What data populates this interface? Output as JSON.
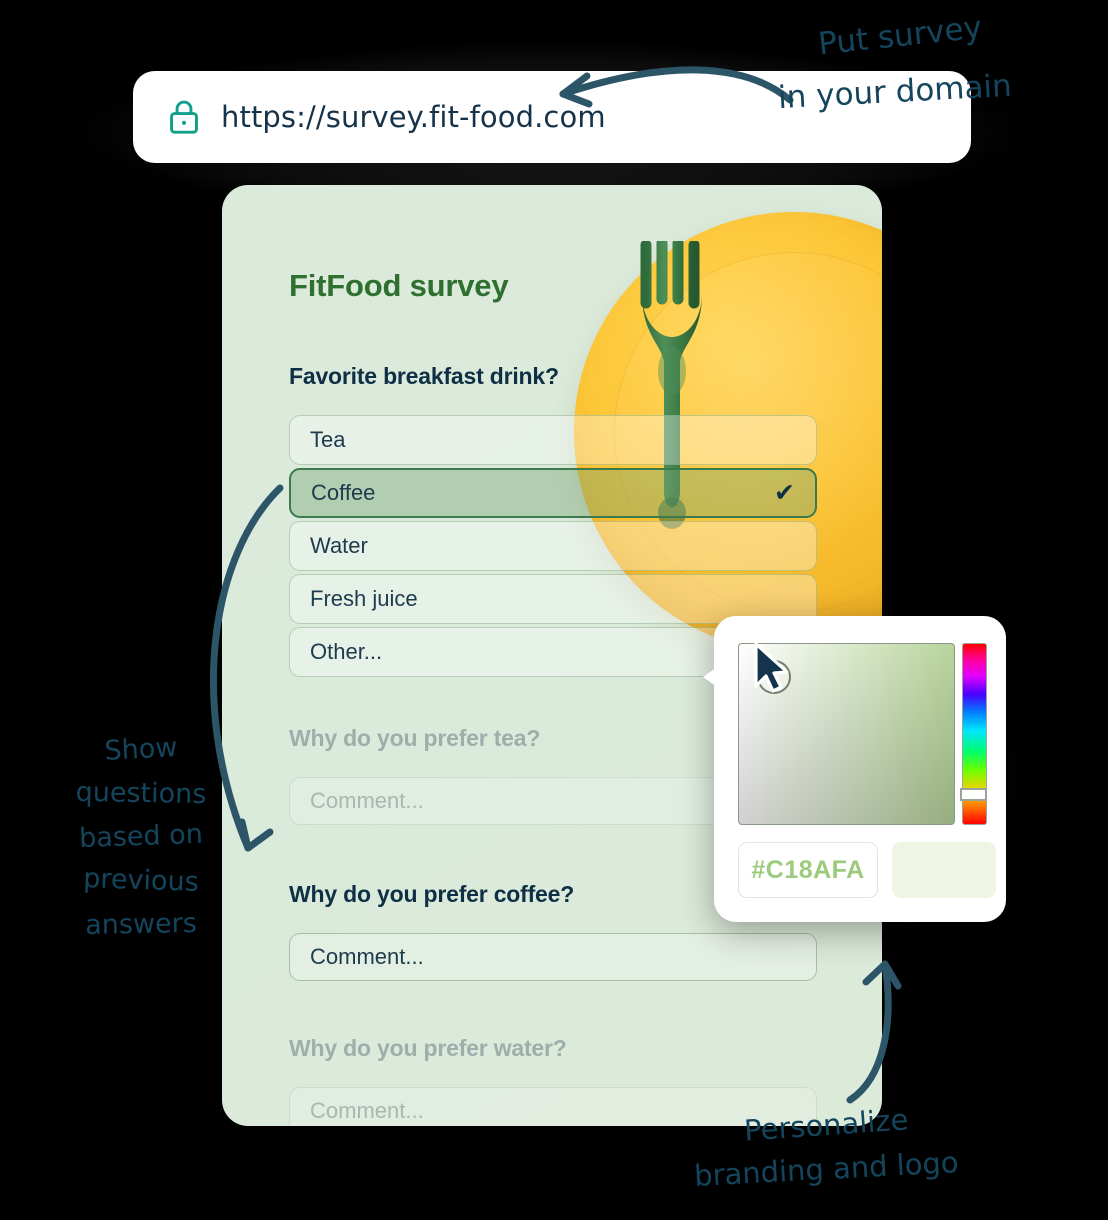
{
  "browser": {
    "lock_icon": "lock-icon",
    "url": "https://survey.fit-food.com"
  },
  "annotations": {
    "domain": {
      "line1": "Put survey",
      "line2": "in your domain"
    },
    "logic": {
      "line1": "Show",
      "line2": "questions",
      "line3": "based on",
      "line4": "previous",
      "line5": "answers"
    },
    "branding": {
      "line1": "Personalize",
      "line2": "branding and logo"
    }
  },
  "survey": {
    "title": "FitFood survey",
    "question_1": {
      "label": "Favorite breakfast drink?",
      "options": [
        {
          "label": "Tea",
          "selected": false
        },
        {
          "label": "Coffee",
          "selected": true
        },
        {
          "label": "Water",
          "selected": false
        },
        {
          "label": "Fresh juice",
          "selected": false
        },
        {
          "label": "Other...",
          "selected": false
        }
      ],
      "check_glyph": "✔"
    },
    "follow_ups": [
      {
        "label": "Why do you prefer tea?",
        "placeholder": "Comment...",
        "state": "disabled"
      },
      {
        "label": "Why do you prefer coffee?",
        "placeholder": "Comment...",
        "state": "active"
      },
      {
        "label": "Why do you prefer water?",
        "placeholder": "Comment...",
        "state": "disabled"
      }
    ]
  },
  "color_picker": {
    "hex_value": "#C18AFA",
    "swatch_color": "#eef5e5"
  },
  "colors": {
    "brand_green": "#2f7031",
    "ink_navy": "#0e2f44",
    "annotation_ink": "#14455c",
    "lock_teal": "#12a08a",
    "plate_yellow": "#fcc637",
    "card_bg": "#dceadb",
    "selected_border": "#3c7a4e"
  }
}
